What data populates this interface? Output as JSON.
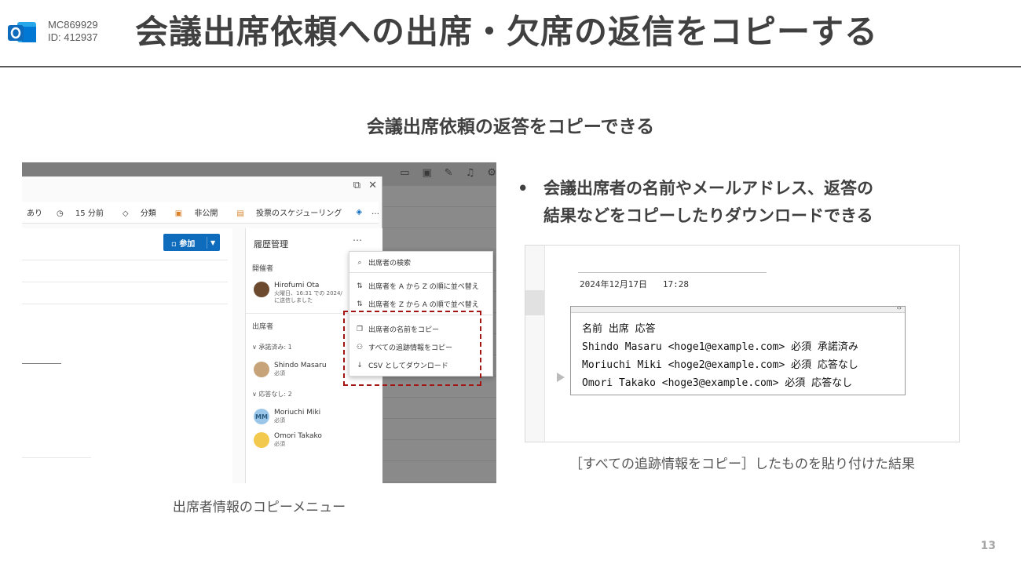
{
  "header": {
    "code": "MC869929",
    "id": "ID: 412937",
    "title": "会議出席依頼への出席・欠席の返信をコピーする"
  },
  "subtitle": "会議出席依頼の返答をコピーできる",
  "left_screenshot": {
    "ribbon": [
      "あり",
      "15 分前",
      "分類",
      "非公開",
      "投票のスケジューリング",
      "…"
    ],
    "join_label": "参加",
    "panel": {
      "title": "履歴管理",
      "organizer_label": "開催者",
      "organizer_name": "Hirofumi Ota",
      "organizer_info1": "火曜日、16:31 での 2024/",
      "organizer_info2": "に送信しました",
      "attendees_label": "出席者",
      "accepted_group": "承諾済み: 1",
      "no_response_group": "応答なし: 2",
      "attendees": [
        {
          "initials": "",
          "name": "Shindo Masaru",
          "role": "必須"
        },
        {
          "initials": "MM",
          "name": "Moriuchi Miki",
          "role": "必須"
        },
        {
          "initials": "",
          "name": "Omori Takako",
          "role": "必須"
        }
      ]
    },
    "menu": {
      "search": "出席者の検索",
      "sort_az": "出席者を A から Z の順に並べ替え",
      "sort_za": "出席者を Z から A の順で並べ替え",
      "copy_names": "出席者の名前をコピー",
      "copy_tracking": "すべての追跡情報をコピー",
      "download_csv": "CSV としてダウンロード"
    },
    "caption": "出席者情報のコピーメニュー"
  },
  "bullet": {
    "line1": "会議出席者の名前やメールアドレス、返答の",
    "line2": "結果などをコピーしたりダウンロードできる"
  },
  "right_screenshot": {
    "date": "2024年12月17日   17:28",
    "lines": [
      "名前 出席 応答",
      "Shindo Masaru <hoge1@example.com> 必須 承諾済み",
      "Moriuchi Miki <hoge2@example.com> 必須 応答なし",
      "Omori Takako <hoge3@example.com> 必須 応答なし"
    ],
    "caption": "［すべての追跡情報をコピー］したものを貼り付けた結果"
  },
  "page_number": "13",
  "colors": {
    "accent": "#0f6cbd",
    "highlight_box": "#a31515",
    "title_text": "#404040"
  }
}
